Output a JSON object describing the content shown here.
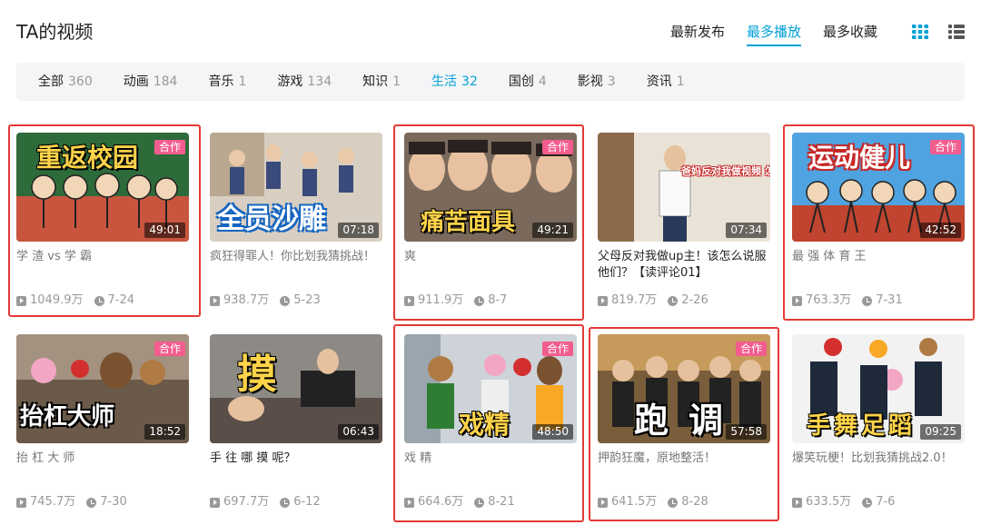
{
  "header": {
    "title": "TA的视频",
    "order_tabs": [
      {
        "label": "最新发布",
        "active": false
      },
      {
        "label": "最多播放",
        "active": true
      },
      {
        "label": "最多收藏",
        "active": false
      }
    ],
    "view_modes": [
      "grid-view-icon",
      "list-view-icon"
    ],
    "accent_color": "#00a1d6"
  },
  "filters": [
    {
      "name": "全部",
      "count": "360",
      "active": false
    },
    {
      "name": "动画",
      "count": "184",
      "active": false
    },
    {
      "name": "音乐",
      "count": "1",
      "active": false
    },
    {
      "name": "游戏",
      "count": "134",
      "active": false
    },
    {
      "name": "知识",
      "count": "1",
      "active": false
    },
    {
      "name": "生活",
      "count": "32",
      "active": true
    },
    {
      "name": "国创",
      "count": "4",
      "active": false
    },
    {
      "name": "影视",
      "count": "3",
      "active": false
    },
    {
      "name": "资讯",
      "count": "1",
      "active": false
    }
  ],
  "videos": [
    {
      "title": "学 渣 vs 学 霸",
      "views": "1049.9万",
      "date": "7-24",
      "duration": "49:01",
      "badge": "合作",
      "thumb_text": "重返校园",
      "highlighted": true
    },
    {
      "title": "疯狂得罪人！你比划我猜挑战！",
      "views": "938.7万",
      "date": "5-23",
      "duration": "07:18",
      "badge": "",
      "thumb_text": "全员沙雕",
      "highlighted": false
    },
    {
      "title": "爽",
      "views": "911.9万",
      "date": "8-7",
      "duration": "49:21",
      "badge": "合作",
      "thumb_text": "痛苦面具",
      "highlighted": true
    },
    {
      "title": "父母反对我做up主！该怎么说服他们？【读评论01】",
      "views": "819.7万",
      "date": "2-26",
      "duration": "07:34",
      "badge": "",
      "thumb_text": "爸妈反对我做视频 怎么办！",
      "highlighted": false
    },
    {
      "title": "最 强 体 育 王",
      "views": "763.3万",
      "date": "7-31",
      "duration": "42:52",
      "badge": "合作",
      "thumb_text": "运动健儿",
      "highlighted": true
    },
    {
      "title": "抬 杠 大 师",
      "views": "745.7万",
      "date": "7-30",
      "duration": "18:52",
      "badge": "合作",
      "thumb_text": "抬杠大师",
      "highlighted": false
    },
    {
      "title": "手 往 哪 摸 呢？",
      "views": "697.7万",
      "date": "6-12",
      "duration": "06:43",
      "badge": "",
      "thumb_text": "摸",
      "highlighted": false
    },
    {
      "title": "戏 精",
      "views": "664.6万",
      "date": "8-21",
      "duration": "48:50",
      "badge": "合作",
      "thumb_text": "戏精",
      "highlighted": true
    },
    {
      "title": "押韵狂魔，原地整活！",
      "views": "641.5万",
      "date": "8-28",
      "duration": "57:58",
      "badge": "合作",
      "thumb_text": "跑调",
      "highlighted": true
    },
    {
      "title": "爆笑玩梗！比划我猜挑战2.0！",
      "views": "633.5万",
      "date": "7-6",
      "duration": "09:25",
      "badge": "",
      "thumb_text": "手舞足蹈",
      "highlighted": false
    }
  ]
}
